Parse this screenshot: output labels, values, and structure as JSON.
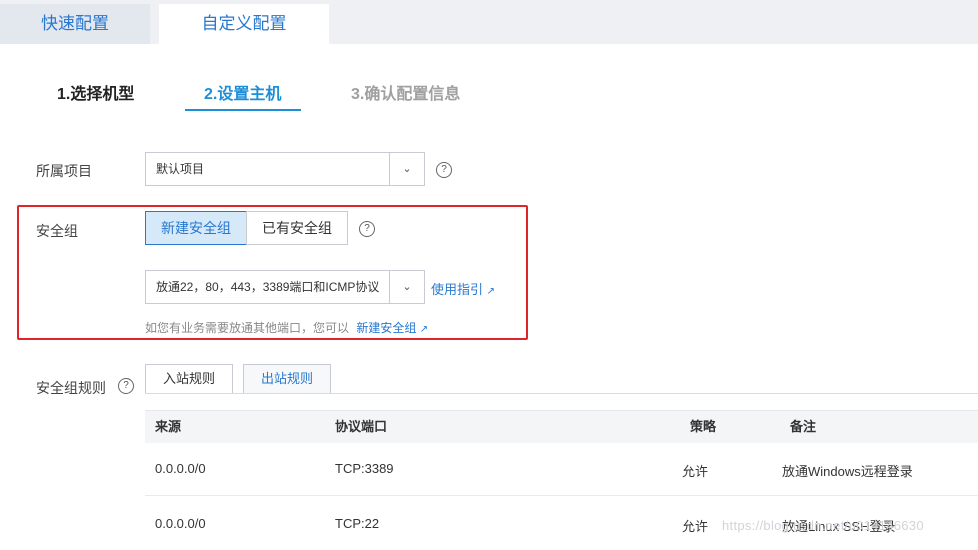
{
  "config_tabs": {
    "quick": "快速配置",
    "custom": "自定义配置"
  },
  "steps": [
    "1.选择机型",
    "2.设置主机",
    "3.确认配置信息"
  ],
  "project": {
    "label": "所属项目",
    "value": "默认项目",
    "help": "?"
  },
  "security_group": {
    "label": "安全组",
    "new_btn": "新建安全组",
    "existing_btn": "已有安全组",
    "help": "?",
    "select_value": "放通22，80，443，3389端口和ICMP协议",
    "guide_link": "使用指引",
    "hint": "如您有业务需要放通其他端口，您可以",
    "hint_link": "新建安全组"
  },
  "rules": {
    "label": "安全组规则",
    "help": "?",
    "tab_in": "入站规则",
    "tab_out": "出站规则",
    "columns": [
      "来源",
      "协议端口",
      "策略",
      "备注"
    ],
    "rows": [
      [
        "0.0.0.0/0",
        "TCP:3389",
        "允许",
        "放通Windows远程登录"
      ],
      [
        "0.0.0.0/0",
        "TCP:22",
        "允许",
        "放通Linux SSH登录"
      ]
    ]
  },
  "icons": {
    "dropdown": "chevron-down-icon",
    "help": "question-circle-icon",
    "external": "external-link-icon"
  },
  "colors": {
    "accent": "#2878cf",
    "active_step": "#1e8ed8",
    "highlight_box": "#e0242b"
  },
  "watermark": "https://blog.csdn.net/u014146630"
}
